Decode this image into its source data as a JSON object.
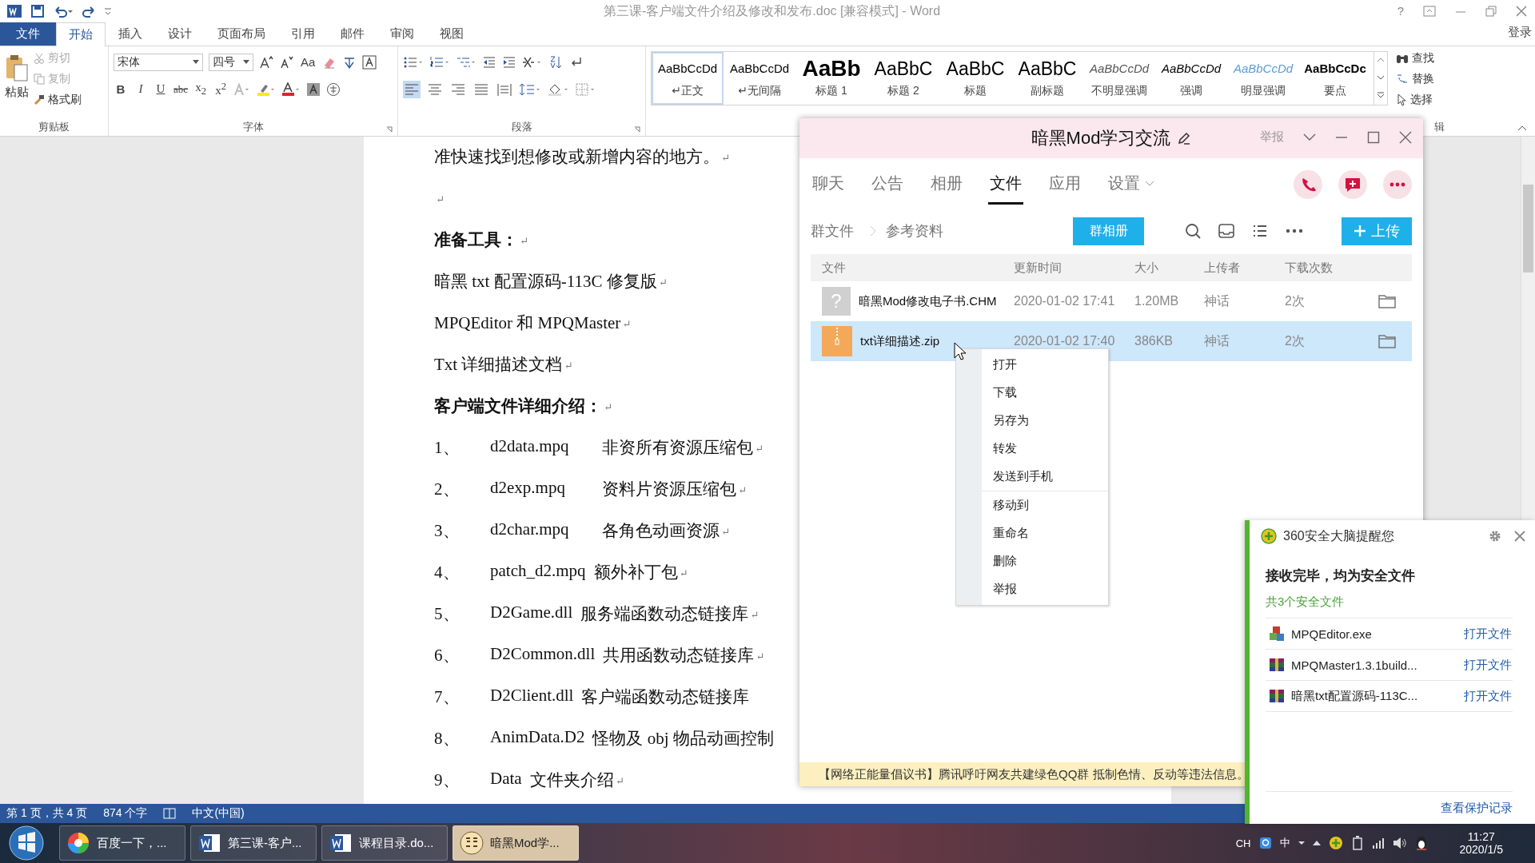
{
  "word": {
    "title": "第三课-客户端文件介绍及修改和发布.doc [兼容模式] - Word",
    "help": "?",
    "login": "登录",
    "tabs": [
      {
        "label": "文件",
        "kind": "file",
        "selected": false
      },
      {
        "label": "开始",
        "kind": "tab",
        "selected": true
      },
      {
        "label": "插入",
        "kind": "tab",
        "selected": false
      },
      {
        "label": "设计",
        "kind": "tab",
        "selected": false
      },
      {
        "label": "页面布局",
        "kind": "tab",
        "selected": false
      },
      {
        "label": "引用",
        "kind": "tab",
        "selected": false
      },
      {
        "label": "邮件",
        "kind": "tab",
        "selected": false
      },
      {
        "label": "审阅",
        "kind": "tab",
        "selected": false
      },
      {
        "label": "视图",
        "kind": "tab",
        "selected": false
      }
    ],
    "clipboard": {
      "paste": "粘贴",
      "cut": "剪切",
      "copy": "复制",
      "format_painter": "格式刷",
      "group": "剪贴板"
    },
    "font": {
      "name": "宋体",
      "size": "四号",
      "case_button": "Aa",
      "group": "字体",
      "format_buttons": [
        {
          "label": "B",
          "kind": "bold"
        },
        {
          "label": "I",
          "kind": "italic"
        },
        {
          "label": "U",
          "kind": "underline"
        },
        {
          "label": "abc",
          "kind": "strike"
        },
        {
          "label": "x$_{2}$",
          "kind": "plain"
        },
        {
          "label": "x$^{2}$",
          "kind": "plain"
        }
      ]
    },
    "paragraph": {
      "group": "段落",
      "alignment_buttons": [
        {
          "kind": "left",
          "selected": true
        },
        {
          "kind": "center",
          "selected": false
        },
        {
          "kind": "right",
          "selected": false
        },
        {
          "kind": "justify",
          "selected": false
        },
        {
          "kind": "distributed",
          "selected": false
        }
      ]
    },
    "styles": [
      {
        "sample": "AaBbCcDd",
        "label": "正文",
        "mark": "↵",
        "kind": "normal",
        "selected": true
      },
      {
        "sample": "AaBbCcDd",
        "label": "无间隔",
        "mark": "↵",
        "kind": "normal",
        "selected": false
      },
      {
        "sample": "AaBb",
        "label": "标题 1",
        "kind": "heading1",
        "selected": false
      },
      {
        "sample": "AaBbC",
        "label": "标题 2",
        "kind": "heading2",
        "selected": false
      },
      {
        "sample": "AaBbC",
        "label": "标题",
        "kind": "title",
        "selected": false
      },
      {
        "sample": "AaBbC",
        "label": "副标题",
        "kind": "title",
        "selected": false
      },
      {
        "sample": "AaBbCcDd",
        "label": "不明显强调",
        "kind": "subtle",
        "selected": false
      },
      {
        "sample": "AaBbCcDd",
        "label": "强调",
        "kind": "emphasis",
        "selected": false
      },
      {
        "sample": "AaBbCcDd",
        "label": "明显强调",
        "kind": "intense",
        "selected": false
      },
      {
        "sample": "AaBbCcDc",
        "label": "要点",
        "kind": "strong",
        "selected": false
      }
    ],
    "editing": {
      "find": "查找",
      "replace": "替换",
      "select": "选择",
      "group": "辑"
    },
    "document": [
      {
        "kind": "text",
        "text": "准快速找到想修改或新增内容的地方。",
        "mark": "↵"
      },
      {
        "kind": "text",
        "mark": "↵"
      },
      {
        "kind": "bold",
        "text": "准备工具：",
        "mark": "↵"
      },
      {
        "kind": "text",
        "text": "暗黑 txt 配置源码-113C 修复版",
        "mark": "↵"
      },
      {
        "kind": "text",
        "text": "MPQEditor 和 MPQMaster",
        "mark": "↵"
      },
      {
        "kind": "text",
        "text": "Txt 详细描述文档",
        "mark": "↵"
      },
      {
        "kind": "bold",
        "text": "客户端文件详细介绍：",
        "mark": "↵"
      },
      {
        "kind": "tabbed",
        "number": "1、",
        "name": "d2data.mpq",
        "text": "非资所有资源压缩包",
        "mark": "↵"
      },
      {
        "kind": "tabbed",
        "number": "2、",
        "name": "d2exp.mpq",
        "text": "资料片资源压缩包",
        "mark": "↵"
      },
      {
        "kind": "tabbed",
        "number": "3、",
        "name": "d2char.mpq",
        "text": "各角色动画资源",
        "mark": "↵"
      },
      {
        "kind": "item",
        "number": "4、",
        "name": "patch_d2.mpq",
        "text": "额外补丁包",
        "mark": "↵"
      },
      {
        "kind": "item",
        "number": "5、",
        "name": "D2Game.dll",
        "text": "服务端函数动态链接库",
        "mark": "↵"
      },
      {
        "kind": "item",
        "number": "6、",
        "name": "D2Common.dll",
        "text": "共用函数动态链接库",
        "mark": "↵"
      },
      {
        "kind": "item",
        "number": "7、",
        "name": "D2Client.dll",
        "text": "客户端函数动态链接库"
      },
      {
        "kind": "item",
        "number": "8、",
        "name": "AnimData.D2",
        "text": "怪物及 obj 物品动画控制"
      },
      {
        "kind": "item",
        "number": "9、",
        "name": "Data",
        "text": "文件夹介绍",
        "mark": "↵"
      }
    ],
    "status_bar": {
      "page": "第 1 页，共 4 页",
      "words": "874 个字",
      "language": "中文(中国)"
    }
  },
  "qq": {
    "title": "暗黑Mod学习交流",
    "report": "举报",
    "tabs": [
      {
        "label": "聊天",
        "selected": false
      },
      {
        "label": "公告",
        "selected": false
      },
      {
        "label": "相册",
        "selected": false
      },
      {
        "label": "文件",
        "selected": true
      },
      {
        "label": "应用",
        "selected": false
      },
      {
        "label": "设置",
        "selected": false,
        "dropdown": true
      }
    ],
    "breadcrumb": [
      "群文件",
      "参考资料"
    ],
    "album_button": "群相册",
    "upload_button": "上传",
    "columns": [
      "文件",
      "更新时间",
      "大小",
      "上传者",
      "下载次数"
    ],
    "rows": [
      {
        "kind": "unknown",
        "badge": "?",
        "name": "暗黑Mod修改电子书.CHM",
        "time": "2020-01-02 17:41",
        "size": "1.20MB",
        "uploader": "神话",
        "downloads": "2次",
        "selected": false
      },
      {
        "kind": "zip",
        "name": "txt详细描述.zip",
        "time": "2020-01-02 17:40",
        "size": "386KB",
        "uploader": "神话",
        "downloads": "2次",
        "selected": true
      }
    ],
    "context_menu": [
      [
        "打开",
        "下载",
        "另存为",
        "转发",
        "发送到手机"
      ],
      [
        "移动到",
        "重命名",
        "删除",
        "举报"
      ]
    ],
    "banner": "【网络正能量倡议书】腾讯呼吁网友共建绿色QQ群 抵制色情、反动等违法信息。"
  },
  "security_popup": {
    "title": "360安全大脑提醒您",
    "heading": "接收完毕，均为安全文件",
    "summary": "共3个安全文件",
    "files": [
      {
        "kind": "exe",
        "name": "MPQEditor.exe",
        "action": "打开文件"
      },
      {
        "kind": "archive",
        "name": "MPQMaster1.3.1build...",
        "action": "打开文件"
      },
      {
        "kind": "archive",
        "name": "暗黑txt配置源码-113C...",
        "action": "打开文件"
      }
    ],
    "link": "查看保护记录"
  },
  "taskbar": {
    "tasks": [
      {
        "kind": "browser",
        "label": "百度一下，...",
        "selected": false
      },
      {
        "kind": "word",
        "label": "第三课-客户...",
        "selected": false
      },
      {
        "kind": "word",
        "label": "课程目录.do...",
        "selected": false
      },
      {
        "kind": "chat",
        "label": "暗黑Mod学...",
        "selected": true
      }
    ],
    "input_lang": "CH",
    "ime": "中",
    "time": "11:27",
    "date": "2020/1/5"
  }
}
